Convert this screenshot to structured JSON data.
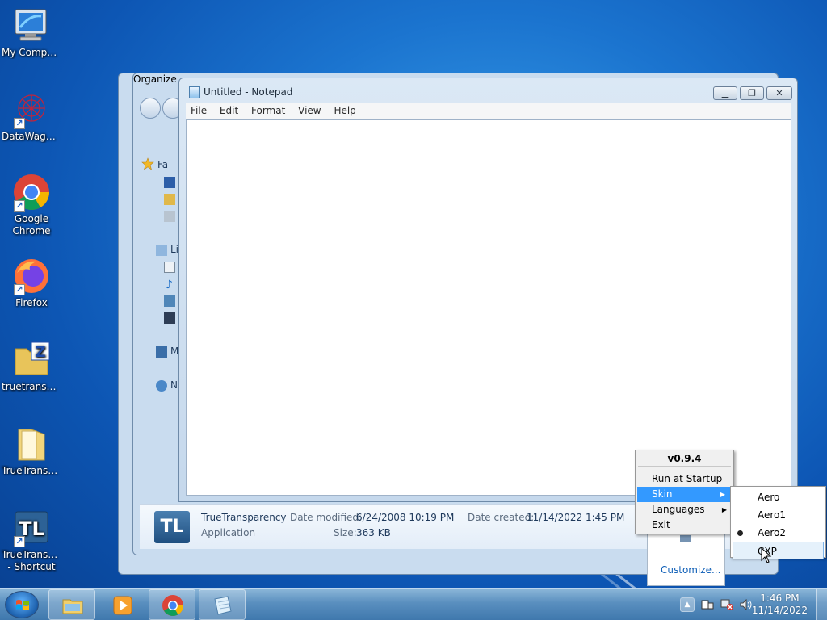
{
  "desktop": {
    "icons": [
      {
        "label": "My Computer",
        "icon": "computer-icon"
      },
      {
        "label": "DataWagon...",
        "icon": "datawagon-icon"
      },
      {
        "label": "Google Chrome",
        "icon": "chrome-icon"
      },
      {
        "label": "Firefox",
        "icon": "firefox-icon"
      },
      {
        "label": "truetranspar...",
        "icon": "zip-folder-icon"
      },
      {
        "label": "TrueTransp...",
        "icon": "folder-icon"
      },
      {
        "label": "TrueTransp... - Shortcut",
        "icon": "truetransparency-icon"
      }
    ]
  },
  "explorer": {
    "toolbar_label": "Organize",
    "nav": {
      "favorites": "Fa",
      "libraries": "Li",
      "computer": "M",
      "network": "N"
    },
    "details": {
      "name": "TrueTransparency",
      "type": "Application",
      "modified_label": "Date modified:",
      "modified_value": "6/24/2008 10:19 PM",
      "created_label": "Date created:",
      "created_value": "11/14/2022 1:45 PM",
      "size_label": "Size:",
      "size_value": "363 KB",
      "icon_text": "TL"
    }
  },
  "notepad": {
    "title": "Untitled - Notepad",
    "menu": [
      "File",
      "Edit",
      "Format",
      "View",
      "Help"
    ],
    "content": ""
  },
  "tray_menu": {
    "version": "v0.9.4",
    "items": [
      "Run at Startup",
      "Skin",
      "Languages",
      "Exit"
    ],
    "selected": "Skin",
    "skin_submenu": [
      "Aero",
      "Aero1",
      "Aero2",
      "CXP"
    ],
    "skin_checked": "Aero2",
    "skin_hover": "CXP"
  },
  "tray_overflow": {
    "customize_label": "Customize..."
  },
  "taskbar": {
    "pinned": [
      "explorer",
      "media-player",
      "chrome",
      "notepad"
    ],
    "clock_time": "1:46 PM",
    "clock_date": "11/14/2022"
  },
  "colors": {
    "accent": "#3399ff",
    "link": "#0f5fb7",
    "details_label": "#5b6b7e",
    "details_value": "#1e395b"
  }
}
